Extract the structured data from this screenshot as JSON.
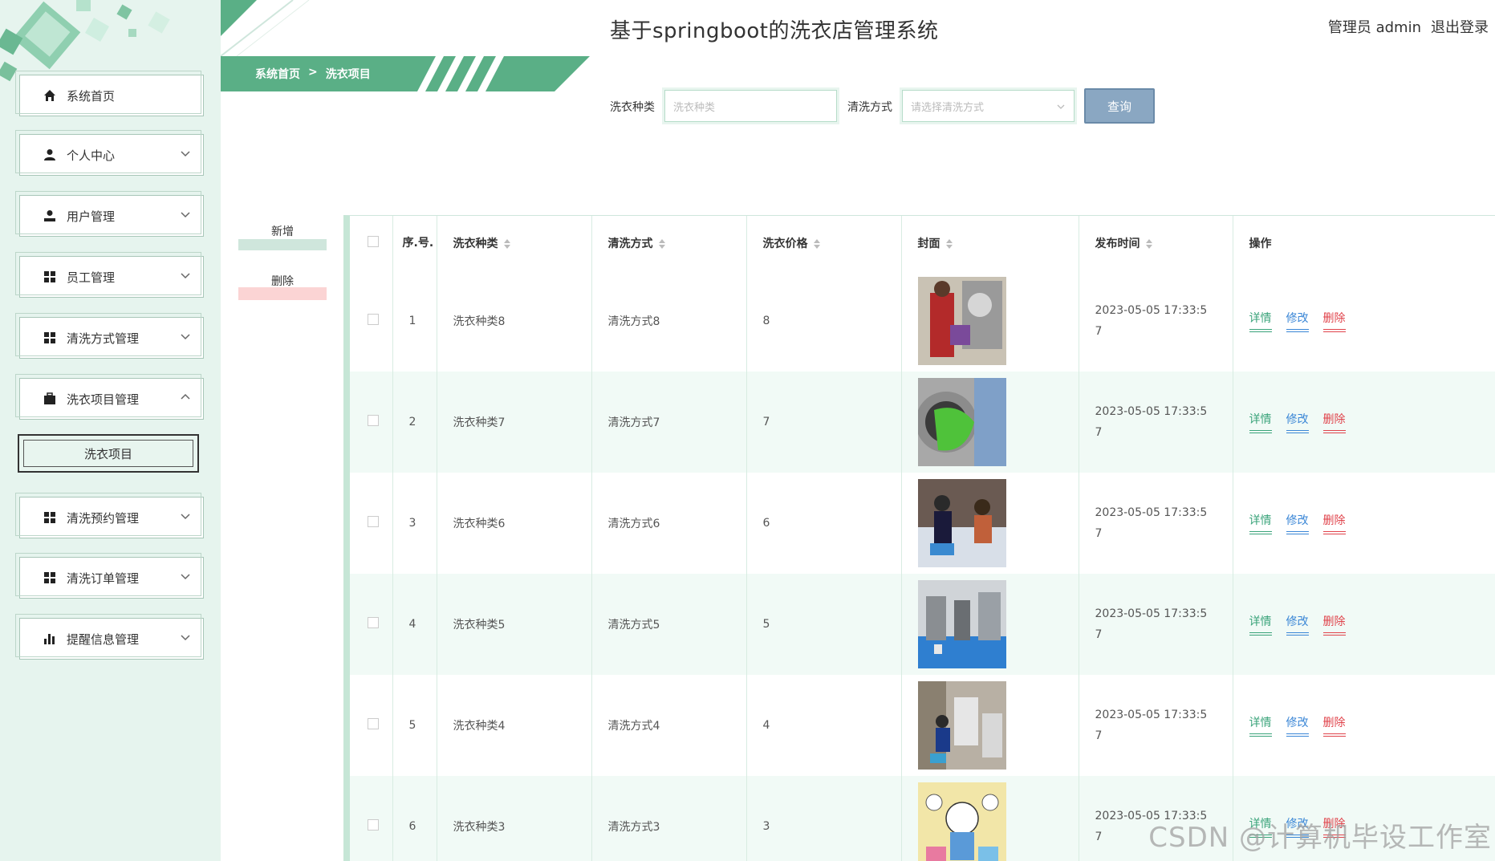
{
  "header": {
    "title": "基于springboot的洗衣店管理系统",
    "user_label": "管理员 admin",
    "logout_label": "退出登录"
  },
  "breadcrumb": {
    "home": "系统首页",
    "separator": ">",
    "current": "洗衣项目"
  },
  "sidebar": {
    "items": [
      {
        "label": "系统首页",
        "icon": "home-icon"
      },
      {
        "label": "个人中心",
        "icon": "user-icon"
      },
      {
        "label": "用户管理",
        "icon": "user-manage-icon"
      },
      {
        "label": "员工管理",
        "icon": "grid-icon"
      },
      {
        "label": "清洗方式管理",
        "icon": "grid-icon"
      },
      {
        "label": "洗衣项目管理",
        "icon": "briefcase-icon"
      },
      {
        "label": "清洗预约管理",
        "icon": "grid-icon"
      },
      {
        "label": "清洗订单管理",
        "icon": "grid-icon"
      },
      {
        "label": "提醒信息管理",
        "icon": "bar-chart-icon"
      }
    ],
    "subitem": {
      "label": "洗衣项目"
    }
  },
  "search": {
    "type_label": "洗衣种类",
    "type_placeholder": "洗衣种类",
    "method_label": "清洗方式",
    "method_placeholder": "请选择清洗方式",
    "button": "查询"
  },
  "actions": {
    "add": "新增",
    "delete": "删除"
  },
  "table": {
    "headers": [
      "序.号.",
      "洗衣种类",
      "清洗方式",
      "洗衣价格",
      "封面",
      "发布时间",
      "操作"
    ],
    "op_labels": {
      "detail": "详情",
      "edit": "修改",
      "delete": "删除"
    },
    "rows": [
      {
        "no": "1",
        "type": "洗衣种类8",
        "method": "清洗方式8",
        "price": "8",
        "time": "2023-05-05 17:33:57"
      },
      {
        "no": "2",
        "type": "洗衣种类7",
        "method": "清洗方式7",
        "price": "7",
        "time": "2023-05-05 17:33:57"
      },
      {
        "no": "3",
        "type": "洗衣种类6",
        "method": "清洗方式6",
        "price": "6",
        "time": "2023-05-05 17:33:57"
      },
      {
        "no": "4",
        "type": "洗衣种类5",
        "method": "清洗方式5",
        "price": "5",
        "time": "2023-05-05 17:33:57"
      },
      {
        "no": "5",
        "type": "洗衣种类4",
        "method": "清洗方式4",
        "price": "4",
        "time": "2023-05-05 17:33:57"
      },
      {
        "no": "6",
        "type": "洗衣种类3",
        "method": "清洗方式3",
        "price": "3",
        "time": "2023-05-05 17:33:57"
      }
    ]
  },
  "watermark": "CSDN @计算机毕设工作室",
  "colors": {
    "accent": "#5aaf86",
    "sidebar_bg": "#e6f4ee",
    "row_alt": "#f1faf6",
    "delete": "#e0434b",
    "edit": "#3a86d6",
    "detail": "#3aa37a"
  }
}
